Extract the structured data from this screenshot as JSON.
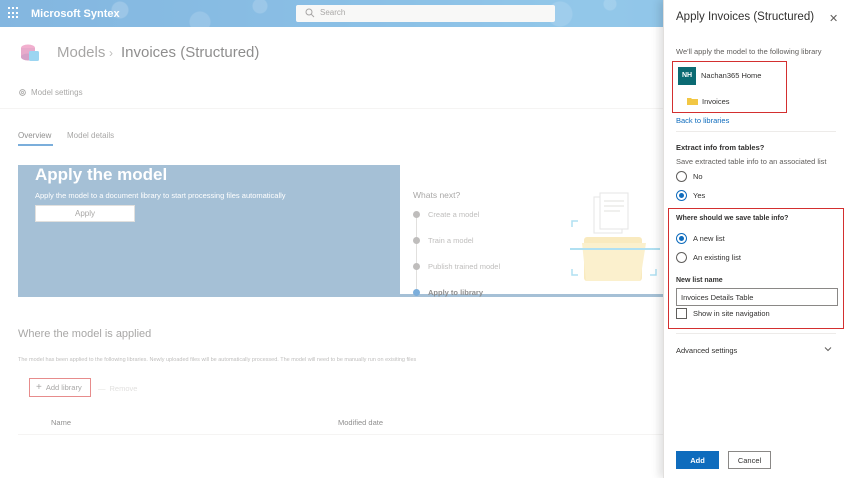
{
  "suite": {
    "app_title": "Microsoft Syntex",
    "search_placeholder": "Search"
  },
  "header": {
    "breadcrumb_root": "Models",
    "breadcrumb_separator": "›",
    "breadcrumb_current": "Invoices (Structured)",
    "settings_label": "Model settings"
  },
  "tabs": [
    {
      "label": "Overview",
      "active": true
    },
    {
      "label": "Model details",
      "active": false
    }
  ],
  "apply_card": {
    "title": "Apply the model",
    "subtitle": "Apply the model to a document library to start processing files automatically",
    "button_label": "Apply"
  },
  "whats_next": {
    "title": "Whats next?",
    "steps": [
      {
        "label": "Create a model",
        "current": false
      },
      {
        "label": "Train a model",
        "current": false
      },
      {
        "label": "Publish trained model",
        "current": false
      },
      {
        "label": "Apply to library",
        "current": true
      }
    ]
  },
  "where_applied": {
    "title": "Where the model is applied",
    "description": "The model has been applied to the following libraries. Newly uploaded files will be automatically processed. The model will need to be manually run on exisiting files",
    "add_library_label": "Add library",
    "remove_label": "Remove",
    "columns": [
      "Name",
      "Modified date"
    ]
  },
  "panel": {
    "title": "Apply Invoices (Structured)",
    "intro": "We'll apply the model to the following library",
    "site_initials": "NH",
    "site_name": "Nachan365 Home",
    "library_name": "Invoices",
    "back_link": "Back to libraries",
    "extract_title": "Extract info from tables?",
    "extract_subtitle": "Save extracted table info to an associated list",
    "extract_options": [
      {
        "label": "No",
        "selected": false
      },
      {
        "label": "Yes",
        "selected": true
      }
    ],
    "save_title": "Where should we save table info?",
    "save_options": [
      {
        "label": "A new list",
        "selected": true
      },
      {
        "label": "An existing list",
        "selected": false
      }
    ],
    "new_list_label": "New list name",
    "new_list_value": "Invoices Details Table",
    "show_nav_label": "Show in site navigation",
    "advanced_label": "Advanced settings",
    "add_button": "Add",
    "cancel_button": "Cancel"
  },
  "colors": {
    "accent": "#0f6cbd",
    "card_blue": "#5b8cb4",
    "highlight_red": "#d32f2f",
    "site_tile": "#0b6a72"
  }
}
